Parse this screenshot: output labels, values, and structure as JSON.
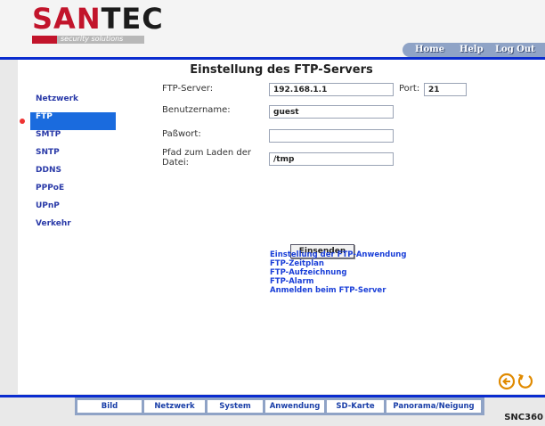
{
  "header": {
    "logo_text": "SANTEC",
    "logo_tagline": "security solutions",
    "nav": [
      "Home",
      "Help",
      "Log Out"
    ]
  },
  "page_title": "Einstellung des FTP-Servers",
  "sidebar": {
    "items": [
      {
        "label": "Netzwerk",
        "active": false
      },
      {
        "label": "FTP",
        "active": true
      },
      {
        "label": "SMTP",
        "active": false
      },
      {
        "label": "SNTP",
        "active": false
      },
      {
        "label": "DDNS",
        "active": false
      },
      {
        "label": "PPPoE",
        "active": false
      },
      {
        "label": "UPnP",
        "active": false
      },
      {
        "label": "Verkehr",
        "active": false
      }
    ]
  },
  "form": {
    "ftp_server_label": "FTP-Server:",
    "ftp_server_value": "192.168.1.1",
    "port_label": "Port:",
    "port_value": "21",
    "username_label": "Benutzername:",
    "username_value": "guest",
    "password_label": "Paßwort:",
    "password_value": "",
    "path_label_1": "Pfad zum Laden der",
    "path_label_2": "Datei:",
    "path_value": "/tmp",
    "submit_label": "Einsenden"
  },
  "links": [
    "Einstellung der FTP-Anwendung",
    "FTP-Zeitplan",
    "FTP-Aufzeichnung",
    "FTP-Alarm",
    "Anmelden beim FTP-Server"
  ],
  "bottom_nav": [
    "Bild",
    "Netzwerk",
    "System",
    "Anwendung",
    "SD-Karte",
    "Panorama/Neigung"
  ],
  "model": "SNC360",
  "icons": [
    "back-circle-icon",
    "refresh-icon"
  ],
  "colors": {
    "accent_blue": "#0a2ccf",
    "active_nav": "#1a6bde",
    "brand_red": "#c2142b",
    "link_blue": "#1a3fd8"
  }
}
